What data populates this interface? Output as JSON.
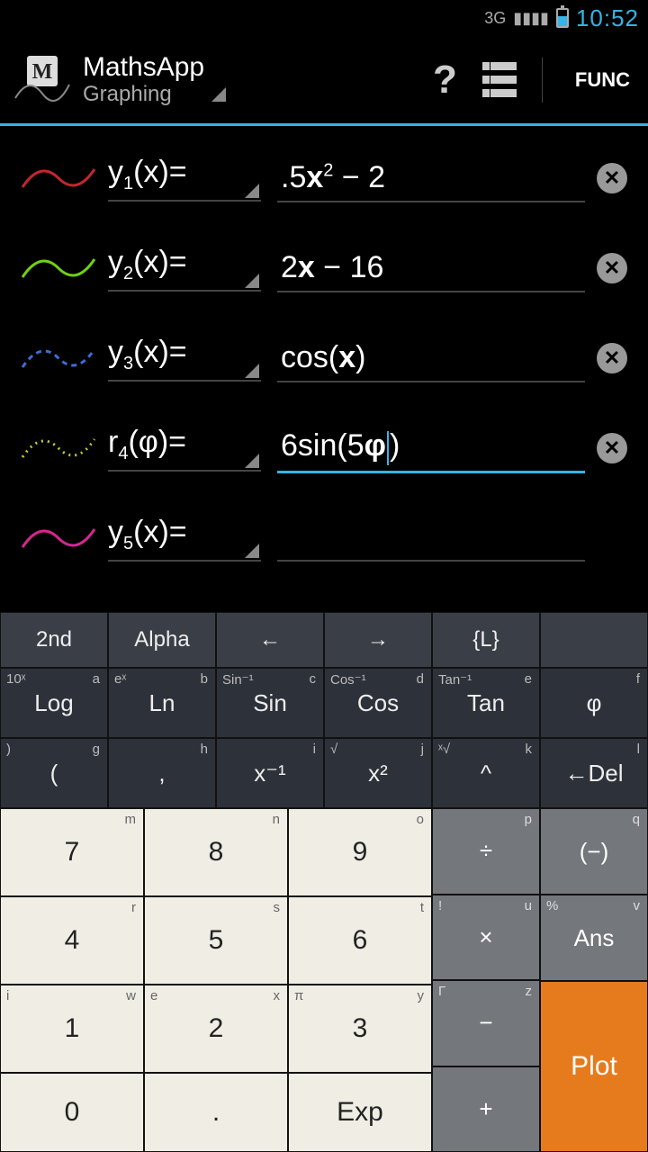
{
  "status": {
    "network": "3G",
    "clock": "10:52"
  },
  "app": {
    "title": "MathsApp",
    "subtitle": "Graphing",
    "func": "FUNC"
  },
  "equations": [
    {
      "label_var": "y",
      "label_sub": "1",
      "label_arg": "(x)=",
      "expr_html": ".5<span class='bold'>x</span><sup>2</sup> − 2",
      "color": "#c1272d",
      "dash": "0",
      "active": false,
      "clearable": true
    },
    {
      "label_var": "y",
      "label_sub": "2",
      "label_arg": "(x)=",
      "expr_html": "2<span class='bold'>x</span> − 16",
      "color": "#6fd016",
      "dash": "0",
      "active": false,
      "clearable": true
    },
    {
      "label_var": "y",
      "label_sub": "3",
      "label_arg": "(x)=",
      "expr_html": "cos(<span class='bold'>x</span>)",
      "color": "#3a6fd1",
      "dash": "6 5",
      "active": false,
      "clearable": true
    },
    {
      "label_var": "r",
      "label_sub": "4",
      "label_arg": "(φ)=",
      "expr_html": "6sin(5<span class='bold'>φ</span><span class='cursor'></span>)",
      "color": "#c9c927",
      "dash": "2 5",
      "active": true,
      "clearable": true
    },
    {
      "label_var": "y",
      "label_sub": "5",
      "label_arg": "(x)=",
      "expr_html": "",
      "color": "#d6268e",
      "dash": "0",
      "active": false,
      "clearable": false
    }
  ],
  "keys": {
    "row1": [
      "2nd",
      "Alpha",
      "←",
      "→",
      "{L}",
      ""
    ],
    "row2": [
      {
        "m": "Log",
        "l": "10ˣ",
        "r": "a"
      },
      {
        "m": "Ln",
        "l": "eˣ",
        "r": "b"
      },
      {
        "m": "Sin",
        "l": "Sin⁻¹",
        "r": "c"
      },
      {
        "m": "Cos",
        "l": "Cos⁻¹",
        "r": "d"
      },
      {
        "m": "Tan",
        "l": "Tan⁻¹",
        "r": "e"
      },
      {
        "m": "φ",
        "l": "",
        "r": "f"
      }
    ],
    "row3": [
      {
        "m": "(",
        "l": ")",
        "r": "g"
      },
      {
        "m": ",",
        "l": "",
        "r": "h"
      },
      {
        "m": "x⁻¹",
        "l": "",
        "r": "i"
      },
      {
        "m": "x²",
        "l": "√",
        "r": "j"
      },
      {
        "m": "^",
        "l": "ˣ√",
        "r": "k"
      },
      {
        "m": "←Del",
        "l": "",
        "r": "l"
      }
    ],
    "num1": [
      {
        "m": "7",
        "r": "m"
      },
      {
        "m": "8",
        "r": "n"
      },
      {
        "m": "9",
        "r": "o"
      }
    ],
    "num2": [
      {
        "m": "4",
        "r": "r"
      },
      {
        "m": "5",
        "r": "s"
      },
      {
        "m": "6",
        "r": "t"
      }
    ],
    "num3": [
      {
        "m": "1",
        "l": "i",
        "r": "w"
      },
      {
        "m": "2",
        "l": "e",
        "r": "x"
      },
      {
        "m": "3",
        "l": "π",
        "r": "y"
      }
    ],
    "num4": [
      {
        "m": "0"
      },
      {
        "m": "."
      },
      {
        "m": "Exp"
      }
    ],
    "opcol1": [
      {
        "m": "÷",
        "r": "p"
      },
      {
        "m": "×",
        "l": "!",
        "r": "u"
      },
      {
        "m": "−",
        "l": "Γ",
        "r": "z"
      },
      {
        "m": "+"
      }
    ],
    "opcol2_top": [
      {
        "m": "(−)",
        "r": "q"
      },
      {
        "m": "Ans",
        "l": "%",
        "r": "v"
      }
    ],
    "plot": "Plot"
  }
}
